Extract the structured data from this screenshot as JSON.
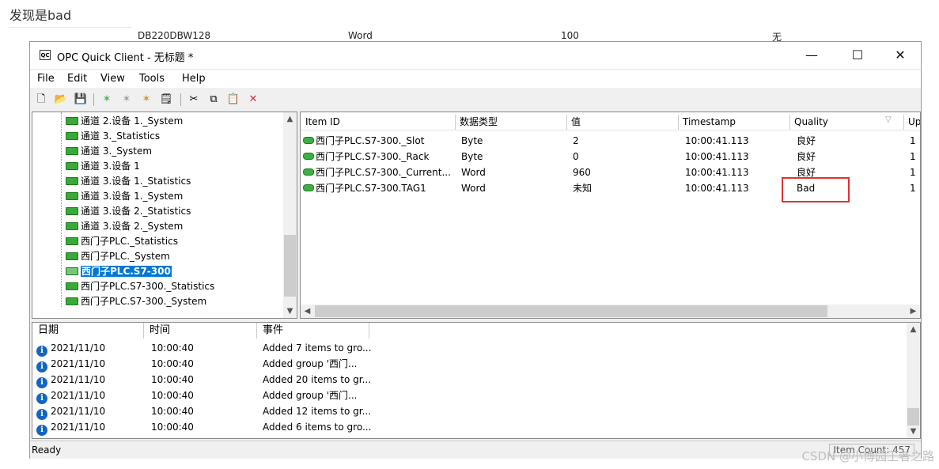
{
  "caption": "发现是bad",
  "background_row": [
    "DB220DBW128",
    "Word",
    "100",
    "无"
  ],
  "window": {
    "icon_text": "QC",
    "title": "OPC Quick Client - 无标题 *",
    "controls": {
      "minimize": "—",
      "maximize": "☐",
      "close": "✕"
    }
  },
  "menu": [
    "File",
    "Edit",
    "View",
    "Tools",
    "Help"
  ],
  "toolbar": {
    "icons": [
      "new-icon",
      "open-icon",
      "save-icon",
      "new-server-icon",
      "new-group-icon",
      "new-item-icon",
      "properties-icon",
      "cut-icon",
      "copy-icon",
      "paste-icon",
      "delete-icon"
    ],
    "glyphs": [
      "🗋",
      "📂",
      "💾",
      "✶",
      "✶",
      "✶",
      "🗒",
      "✂",
      "⧉",
      "📋",
      "✕"
    ]
  },
  "tree": {
    "items": [
      "通道 2.设备 1._System",
      "通道 3._Statistics",
      "通道 3._System",
      "通道 3.设备 1",
      "通道 3.设备 1._Statistics",
      "通道 3.设备 1._System",
      "通道 3.设备 2._Statistics",
      "通道 3.设备 2._System",
      "西门子PLC._Statistics",
      "西门子PLC._System",
      "西门子PLC.S7-300",
      "西门子PLC.S7-300._Statistics",
      "西门子PLC.S7-300._System"
    ],
    "selected_index": 10
  },
  "items_table": {
    "headers": [
      "Item ID",
      "数据类型",
      "值",
      "Timestamp",
      "Quality",
      "Up"
    ],
    "rows": [
      [
        "西门子PLC.S7-300._Slot",
        "Byte",
        "2",
        "10:00:41.113",
        "良好",
        "1"
      ],
      [
        "西门子PLC.S7-300._Rack",
        "Byte",
        "0",
        "10:00:41.113",
        "良好",
        "1"
      ],
      [
        "西门子PLC.S7-300._Current...",
        "Word",
        "960",
        "10:00:41.113",
        "良好",
        "1"
      ],
      [
        "西门子PLC.S7-300.TAG1",
        "Word",
        "未知",
        "10:00:41.113",
        "Bad",
        "1"
      ]
    ]
  },
  "log": {
    "headers": [
      "日期",
      "时间",
      "事件"
    ],
    "rows": [
      [
        "2021/11/10",
        "10:00:40",
        "Added 7 items to gro..."
      ],
      [
        "2021/11/10",
        "10:00:40",
        "Added group '西门..."
      ],
      [
        "2021/11/10",
        "10:00:40",
        "Added 20 items to gr..."
      ],
      [
        "2021/11/10",
        "10:00:40",
        "Added group '西门..."
      ],
      [
        "2021/11/10",
        "10:00:40",
        "Added 12 items to gr..."
      ],
      [
        "2021/11/10",
        "10:00:40",
        "Added 6 items to gro..."
      ]
    ]
  },
  "status": {
    "left": "Ready",
    "right": "Item Count: 457"
  },
  "watermark": "CSDN @小博园王者之路"
}
